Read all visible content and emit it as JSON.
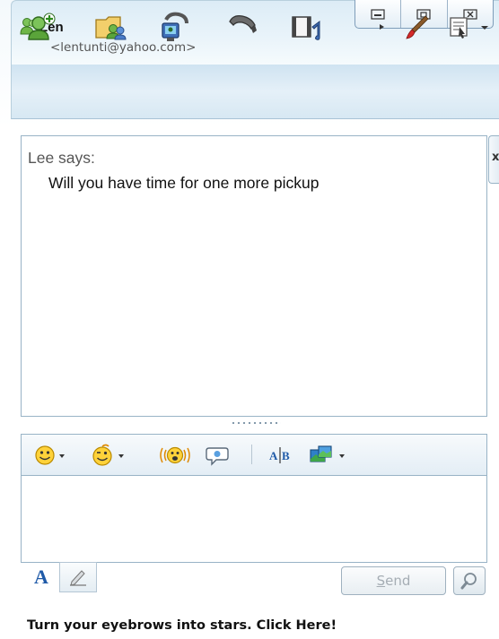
{
  "header": {
    "buddy_name": "Len",
    "buddy_email": "<lentunti@yahoo.com>"
  },
  "window_controls": [
    "minimize-icon",
    "restore-icon",
    "close-icon"
  ],
  "toolbar": {
    "icons": [
      "add-contact-icon",
      "share-files-icon",
      "webcam-icon",
      "call-icon",
      "video-icon",
      "more-arrow-icon",
      "paintbrush-icon",
      "view-menu-icon"
    ]
  },
  "conversation": {
    "sender_line": "Lee says:",
    "message": "Will you have time for one more pickup"
  },
  "side_tab": {
    "label": "x"
  },
  "format_bar": {
    "icons": [
      "smiley-icon",
      "wink-icon",
      "buzz-icon",
      "audible-icon",
      "spellcheck-icon",
      "photo-share-icon"
    ]
  },
  "compose": {
    "value": "",
    "placeholder": "",
    "font_label": "A",
    "send_prefix": "",
    "send_access_key": "S",
    "send_rest": "end"
  },
  "ad": {
    "text": "Turn your eyebrows into stars. Click Here!"
  },
  "colors": {
    "header_bg": "#dcecf6",
    "toolbar_bg": "#d7e8f3",
    "border": "#98b3c6",
    "font_button": "#1f5aa8",
    "send_disabled_text": "#a5adb4"
  }
}
